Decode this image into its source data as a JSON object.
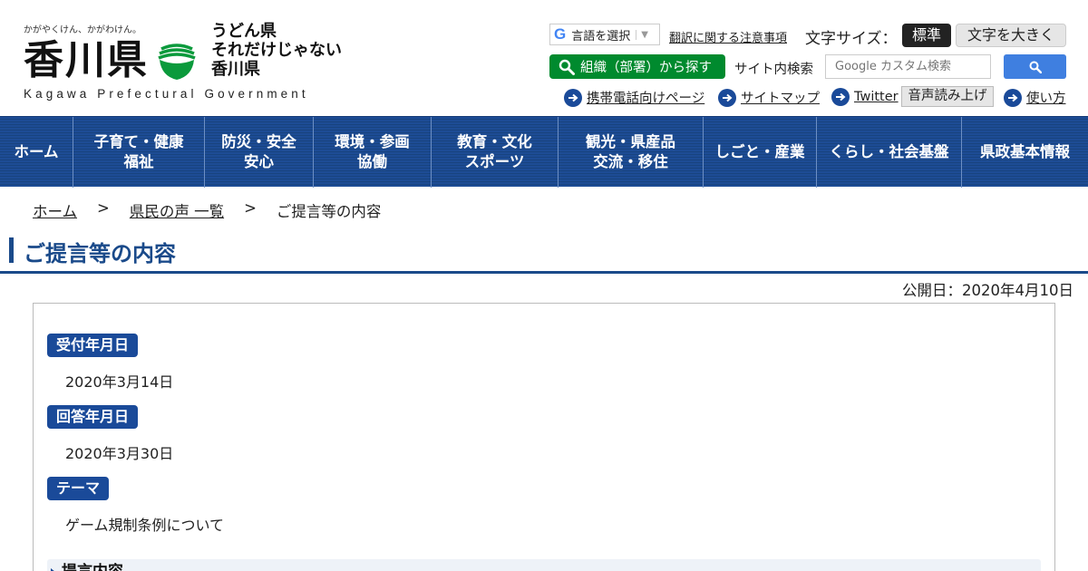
{
  "header": {
    "logo": {
      "tagline": "かがやくけん、かがわけん。",
      "name": "香川県",
      "slogan_lines": [
        "うどん県",
        "それだけじゃない",
        "香川県"
      ],
      "subtitle": "Kagawa Prefectural Government"
    },
    "translate": {
      "label": "言語を選択",
      "caret": "▼",
      "note": "翻訳に関する注意事項"
    },
    "font_size": {
      "label": "文字サイズ：",
      "standard": "標準",
      "larger": "文字を大きく"
    },
    "org_search_label": "組織（部署）から探す",
    "site_search": {
      "label": "サイト内検索",
      "placeholder": "Google カスタム検索"
    },
    "util_links": {
      "mobile": "携帯電話向けページ",
      "sitemap": "サイトマップ",
      "twitter": "Twitter",
      "tts": "音声読み上げ",
      "howto": "使い方"
    }
  },
  "nav": {
    "items": [
      {
        "label": "ホーム"
      },
      {
        "label": "子育て・健康\n福祉"
      },
      {
        "label": "防災・安全\n安心"
      },
      {
        "label": "環境・参画\n協働"
      },
      {
        "label": "教育・文化\nスポーツ"
      },
      {
        "label": "観光・県産品\n交流・移住"
      },
      {
        "label": "しごと・産業"
      },
      {
        "label": "くらし・社会基盤"
      },
      {
        "label": "県政基本情報"
      }
    ]
  },
  "breadcrumb": {
    "home": "ホーム",
    "sep": ">",
    "list": "県民の声 一覧",
    "current": "ご提言等の内容"
  },
  "page": {
    "title": "ご提言等の内容",
    "published": "公開日：2020年4月10日"
  },
  "details": {
    "received_label": "受付年月日",
    "received_value": "2020年3月14日",
    "answered_label": "回答年月日",
    "answered_value": "2020年3月30日",
    "theme_label": "テーマ",
    "theme_value": "ゲーム規制条例について",
    "proposal_heading": "提言内容"
  },
  "colors": {
    "nav_blue": "#1d4c95",
    "badge_blue": "#1a4a99",
    "title_blue": "#1a4a8a",
    "org_search_green": "#008a2e",
    "search_button_blue": "#3f7fe0"
  },
  "icons": [
    "emblem-icon",
    "google-g-icon",
    "search-icon",
    "arrow-right-icon"
  ]
}
